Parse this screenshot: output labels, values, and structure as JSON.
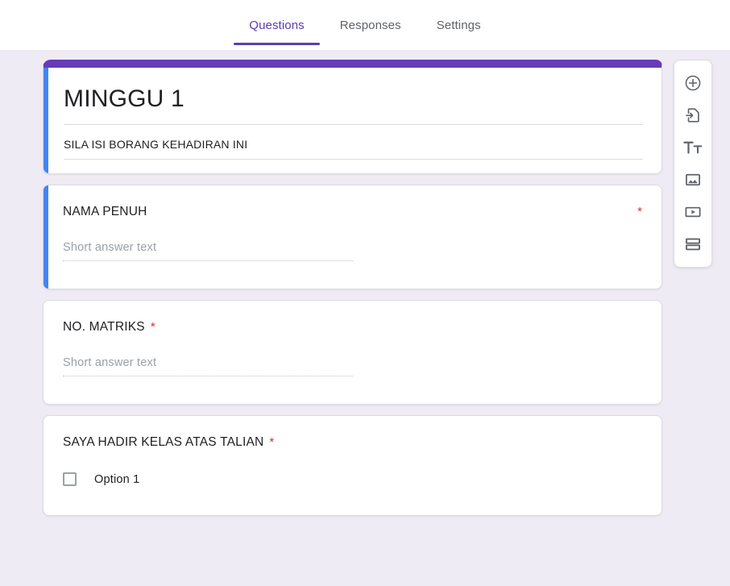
{
  "tabs": [
    {
      "label": "Questions",
      "name": "tab-questions",
      "active": true
    },
    {
      "label": "Responses",
      "name": "tab-responses",
      "active": false
    },
    {
      "label": "Settings",
      "name": "tab-settings",
      "active": false
    }
  ],
  "form": {
    "title": "MINGGU 1",
    "description": "SILA ISI BORANG KEHADIRAN INI",
    "header_bar_color": "#673ab7",
    "selected_accent_color": "#4285f4"
  },
  "questions": [
    {
      "title": "NAMA PENUH",
      "required": true,
      "required_marker": "*",
      "type": "short-answer",
      "placeholder": "Short answer text",
      "selected": true
    },
    {
      "title": "NO. MATRIKS",
      "required": true,
      "required_marker": "*",
      "type": "short-answer",
      "placeholder": "Short answer text",
      "selected": false
    },
    {
      "title": "SAYA HADIR KELAS ATAS TALIAN",
      "required": true,
      "required_marker": "*",
      "type": "checkbox",
      "options": [
        {
          "label": "Option 1",
          "checked": false
        }
      ],
      "selected": false
    }
  ],
  "toolbar": {
    "items": [
      {
        "name": "add-question-icon",
        "label": "Add question"
      },
      {
        "name": "import-questions-icon",
        "label": "Import questions"
      },
      {
        "name": "add-title-icon",
        "label": "Add title and description"
      },
      {
        "name": "add-image-icon",
        "label": "Add image"
      },
      {
        "name": "add-video-icon",
        "label": "Add video"
      },
      {
        "name": "add-section-icon",
        "label": "Add section"
      }
    ]
  },
  "colors": {
    "accent_purple": "#5b3cb4",
    "header_purple": "#673ab7",
    "blue_accent": "#4285f4",
    "required_red": "#d93025",
    "page_background": "#efebf4"
  }
}
